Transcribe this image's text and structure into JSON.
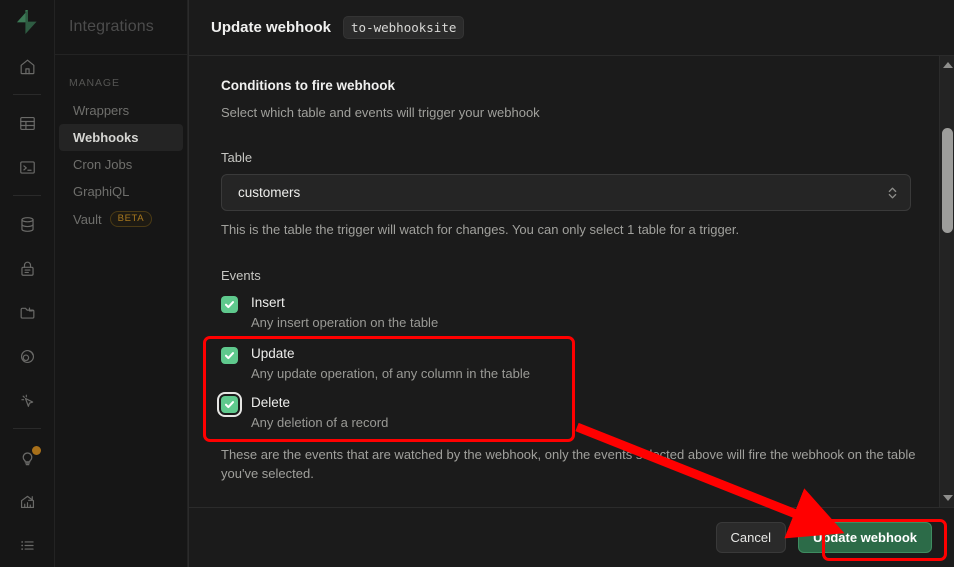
{
  "rail": {
    "logo": "supabase-logo",
    "items": [
      {
        "name": "home-icon",
        "label": "Home"
      },
      {
        "name": "table-editor-icon",
        "label": "Table Editor"
      },
      {
        "name": "sql-editor-icon",
        "label": "SQL Editor"
      },
      {
        "name": "database-icon",
        "label": "Database"
      },
      {
        "name": "auth-icon",
        "label": "Authentication"
      },
      {
        "name": "storage-icon",
        "label": "Storage"
      },
      {
        "name": "edge-functions-icon",
        "label": "Edge Functions"
      },
      {
        "name": "realtime-icon",
        "label": "Realtime"
      },
      {
        "name": "advisors-icon",
        "label": "Advisors"
      },
      {
        "name": "reports-icon",
        "label": "Reports"
      },
      {
        "name": "logs-icon",
        "label": "Logs"
      }
    ]
  },
  "sidebar": {
    "title": "Integrations",
    "section_label": "MANAGE",
    "items": [
      {
        "label": "Wrappers",
        "active": false,
        "badge": ""
      },
      {
        "label": "Webhooks",
        "active": true,
        "badge": ""
      },
      {
        "label": "Cron Jobs",
        "active": false,
        "badge": ""
      },
      {
        "label": "GraphiQL",
        "active": false,
        "badge": ""
      },
      {
        "label": "Vault",
        "active": false,
        "badge": "BETA"
      }
    ]
  },
  "dialog": {
    "title": "Update webhook",
    "name_chip": "to-webhooksite",
    "section_title": "Conditions to fire webhook",
    "section_subtitle": "Select which table and events will trigger your webhook",
    "table_label": "Table",
    "table_value": "customers",
    "table_help": "This is the table the trigger will watch for changes. You can only select 1 table for a trigger.",
    "events_label": "Events",
    "events": [
      {
        "name": "Insert",
        "description": "Any insert operation on the table",
        "checked": true,
        "focused": false
      },
      {
        "name": "Update",
        "description": "Any update operation, of any column in the table",
        "checked": true,
        "focused": false
      },
      {
        "name": "Delete",
        "description": "Any deletion of a record",
        "checked": true,
        "focused": true
      }
    ],
    "events_help": "These are the events that are watched by the webhook, only the events selected above will fire the webhook on the table you've selected.",
    "cancel_label": "Cancel",
    "submit_label": "Update webhook"
  },
  "colors": {
    "accent_green": "#5fc98d",
    "primary_button": "#2c6b48",
    "annotation_red": "#ff0000",
    "beta_badge": "#a8781e"
  },
  "annotations": {
    "events_box": "highlight-update-and-delete-events",
    "button_box": "highlight-update-webhook-button",
    "arrow": "arrow-pointing-to-update-webhook-button"
  }
}
